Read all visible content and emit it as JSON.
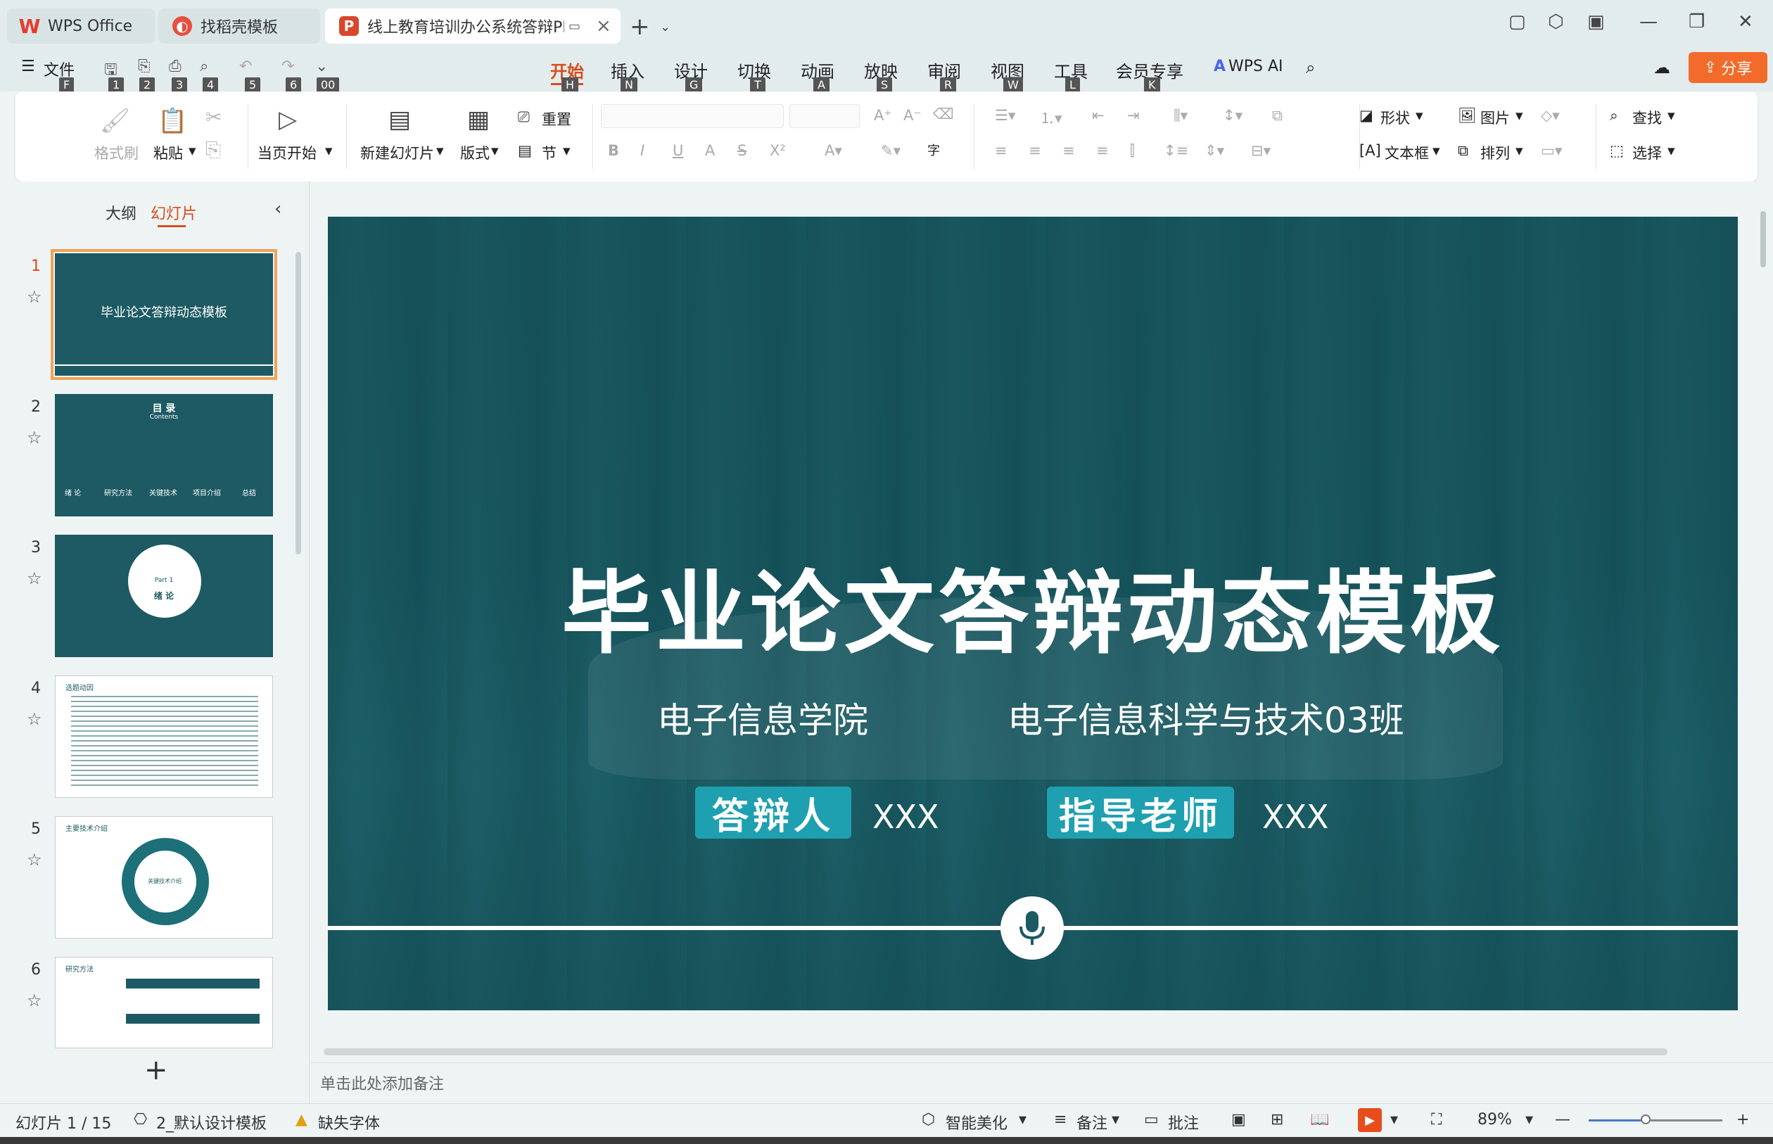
{
  "tabs": [
    {
      "label": "WPS Office"
    },
    {
      "label": "找稻壳模板"
    },
    {
      "label": "线上教育培训办公系统答辩PPT"
    }
  ],
  "menubar": {
    "file_label": "文件",
    "qat_keys": [
      "F",
      "1",
      "2",
      "3",
      "4",
      "5",
      "6",
      "00"
    ],
    "menus": [
      {
        "label": "开始",
        "key": "H"
      },
      {
        "label": "插入",
        "key": "N"
      },
      {
        "label": "设计",
        "key": "G"
      },
      {
        "label": "切换",
        "key": "T"
      },
      {
        "label": "动画",
        "key": "A"
      },
      {
        "label": "放映",
        "key": "S"
      },
      {
        "label": "审阅",
        "key": "R"
      },
      {
        "label": "视图",
        "key": "W"
      },
      {
        "label": "工具",
        "key": "L"
      },
      {
        "label": "会员专享",
        "key": "K"
      }
    ],
    "wps_ai": "WPS AI",
    "share": "分享"
  },
  "ribbon": {
    "format_painter": "格式刷",
    "paste": "粘贴",
    "play_from_current": "当页开始",
    "new_slide": "新建幻灯片",
    "layout": "版式",
    "reset": "重置",
    "section": "节",
    "shape": "形状",
    "picture": "图片",
    "textbox": "文本框",
    "arrange": "排列",
    "find": "查找",
    "select": "选择"
  },
  "leftpanel": {
    "tab_outline": "大纲",
    "tab_slides": "幻灯片",
    "slides": [
      {
        "num": "1"
      },
      {
        "num": "2"
      },
      {
        "num": "3"
      },
      {
        "num": "4"
      },
      {
        "num": "5"
      },
      {
        "num": "6"
      }
    ],
    "thumb1_title": "毕业论文答辩动态模板",
    "thumb2_title": "目 录",
    "thumb2_sub": "Contents",
    "thumb2_items": [
      "绪 论",
      "研究方法",
      "关键技术",
      "项目介绍",
      "总结"
    ],
    "thumb3_part": "Part 1",
    "thumb3_title": "绪 论",
    "thumb4_title": "选题动因",
    "thumb5_title": "主要技术介绍",
    "thumb5_center": "关键技术介绍",
    "thumb6_title": "研究方法"
  },
  "slide": {
    "title": "毕业论文答辩动态模板",
    "college": "电子信息学院",
    "class": "电子信息科学与技术03班",
    "defender_label": "答辩人",
    "defender_value": "XXX",
    "advisor_label": "指导老师",
    "advisor_value": "XXX"
  },
  "notes": {
    "placeholder": "单击此处添加备注"
  },
  "statusbar": {
    "slide_count": "幻灯片 1 / 15",
    "template": "2_默认设计模板",
    "missing_font": "缺失字体",
    "smart_beautify": "智能美化",
    "notes": "备注",
    "comments": "批注",
    "zoom": "89%"
  }
}
